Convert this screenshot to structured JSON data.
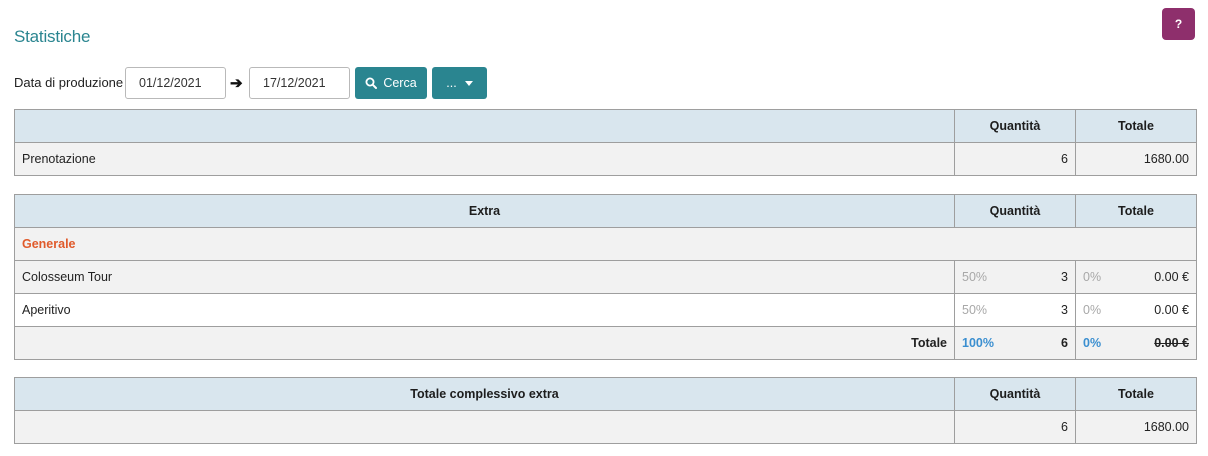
{
  "page": {
    "title": "Statistiche",
    "help_label": "?"
  },
  "filters": {
    "label": "Data di produzione",
    "date_from": "01/12/2021",
    "date_to": "17/12/2021",
    "search_label": "Cerca",
    "more_label": "..."
  },
  "table_booking": {
    "headers": {
      "name": "",
      "quantity": "Quantità",
      "total": "Totale"
    },
    "row": {
      "name": "Prenotazione",
      "quantity": "6",
      "total": "1680.00"
    }
  },
  "table_extra": {
    "headers": {
      "name": "Extra",
      "quantity": "Quantità",
      "total": "Totale"
    },
    "group": "Generale",
    "rows": [
      {
        "name": "Colosseum Tour",
        "qty_pct": "50%",
        "quantity": "3",
        "total_pct": "0%",
        "total": "0.00 €"
      },
      {
        "name": "Aperitivo",
        "qty_pct": "50%",
        "quantity": "3",
        "total_pct": "0%",
        "total": "0.00 €"
      }
    ],
    "summary": {
      "label": "Totale",
      "qty_pct": "100%",
      "quantity": "6",
      "total_pct": "0%",
      "total": "0.00 €"
    }
  },
  "table_grand": {
    "headers": {
      "name": "Totale complessivo extra",
      "quantity": "Quantità",
      "total": "Totale"
    },
    "row": {
      "name": "",
      "quantity": "6",
      "total": "1680.00"
    }
  },
  "colors": {
    "accent": "#2a8590",
    "help": "#8e2f6c",
    "header_bg": "#d9e6ee",
    "group": "#e05a2b",
    "pct_highlight": "#3b8fd0"
  }
}
